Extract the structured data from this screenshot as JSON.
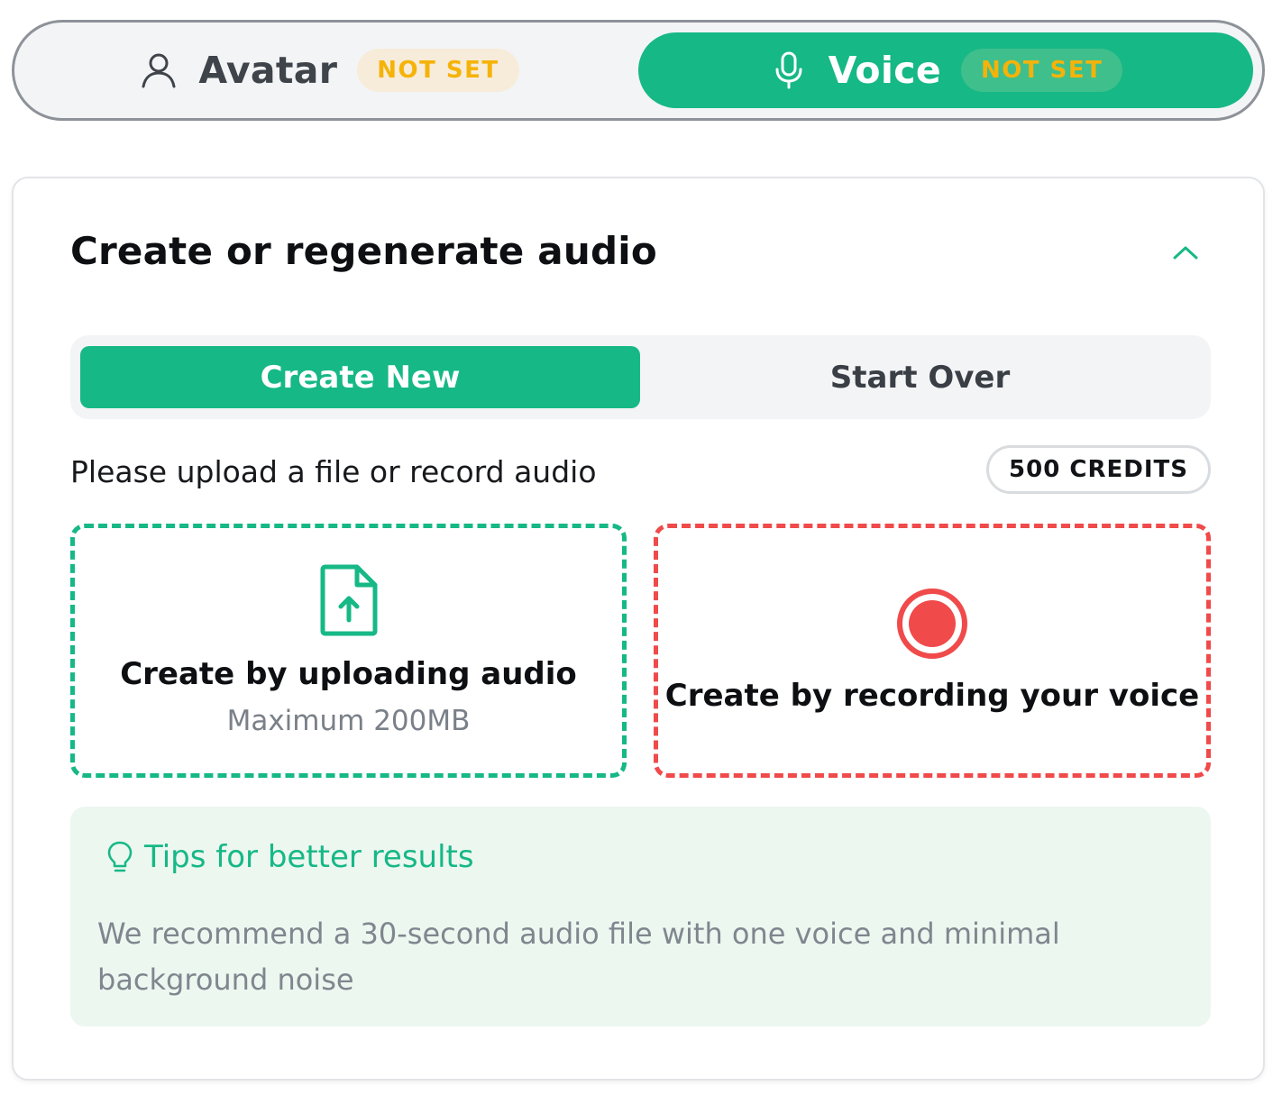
{
  "top_switch": {
    "avatar": {
      "label": "Avatar",
      "badge": "NOT SET",
      "icon": "user-icon"
    },
    "voice": {
      "label": "Voice",
      "badge": "NOT SET",
      "icon": "microphone-icon",
      "selected": true
    }
  },
  "card": {
    "title": "Create or regenerate audio",
    "collapse_icon": "chevron-up-icon",
    "segments": {
      "create_new": "Create New",
      "start_over": "Start Over",
      "selected": "create_new"
    },
    "prompt": "Please upload a file or record audio",
    "credits": "500 CREDITS",
    "upload": {
      "title": "Create by uploading audio",
      "subtitle": "Maximum 200MB",
      "icon": "file-upload-icon"
    },
    "record": {
      "title": "Create by recording your voice",
      "icon": "record-icon"
    },
    "tips": {
      "title": "Tips for better results",
      "icon": "lightbulb-icon",
      "body": "We recommend a 30-second audio file with one voice and minimal background noise"
    }
  },
  "colors": {
    "accent": "#16b886",
    "badge_text": "#f5b30a",
    "record_red": "#f04a4a",
    "tips_bg": "#ecf7f0"
  }
}
